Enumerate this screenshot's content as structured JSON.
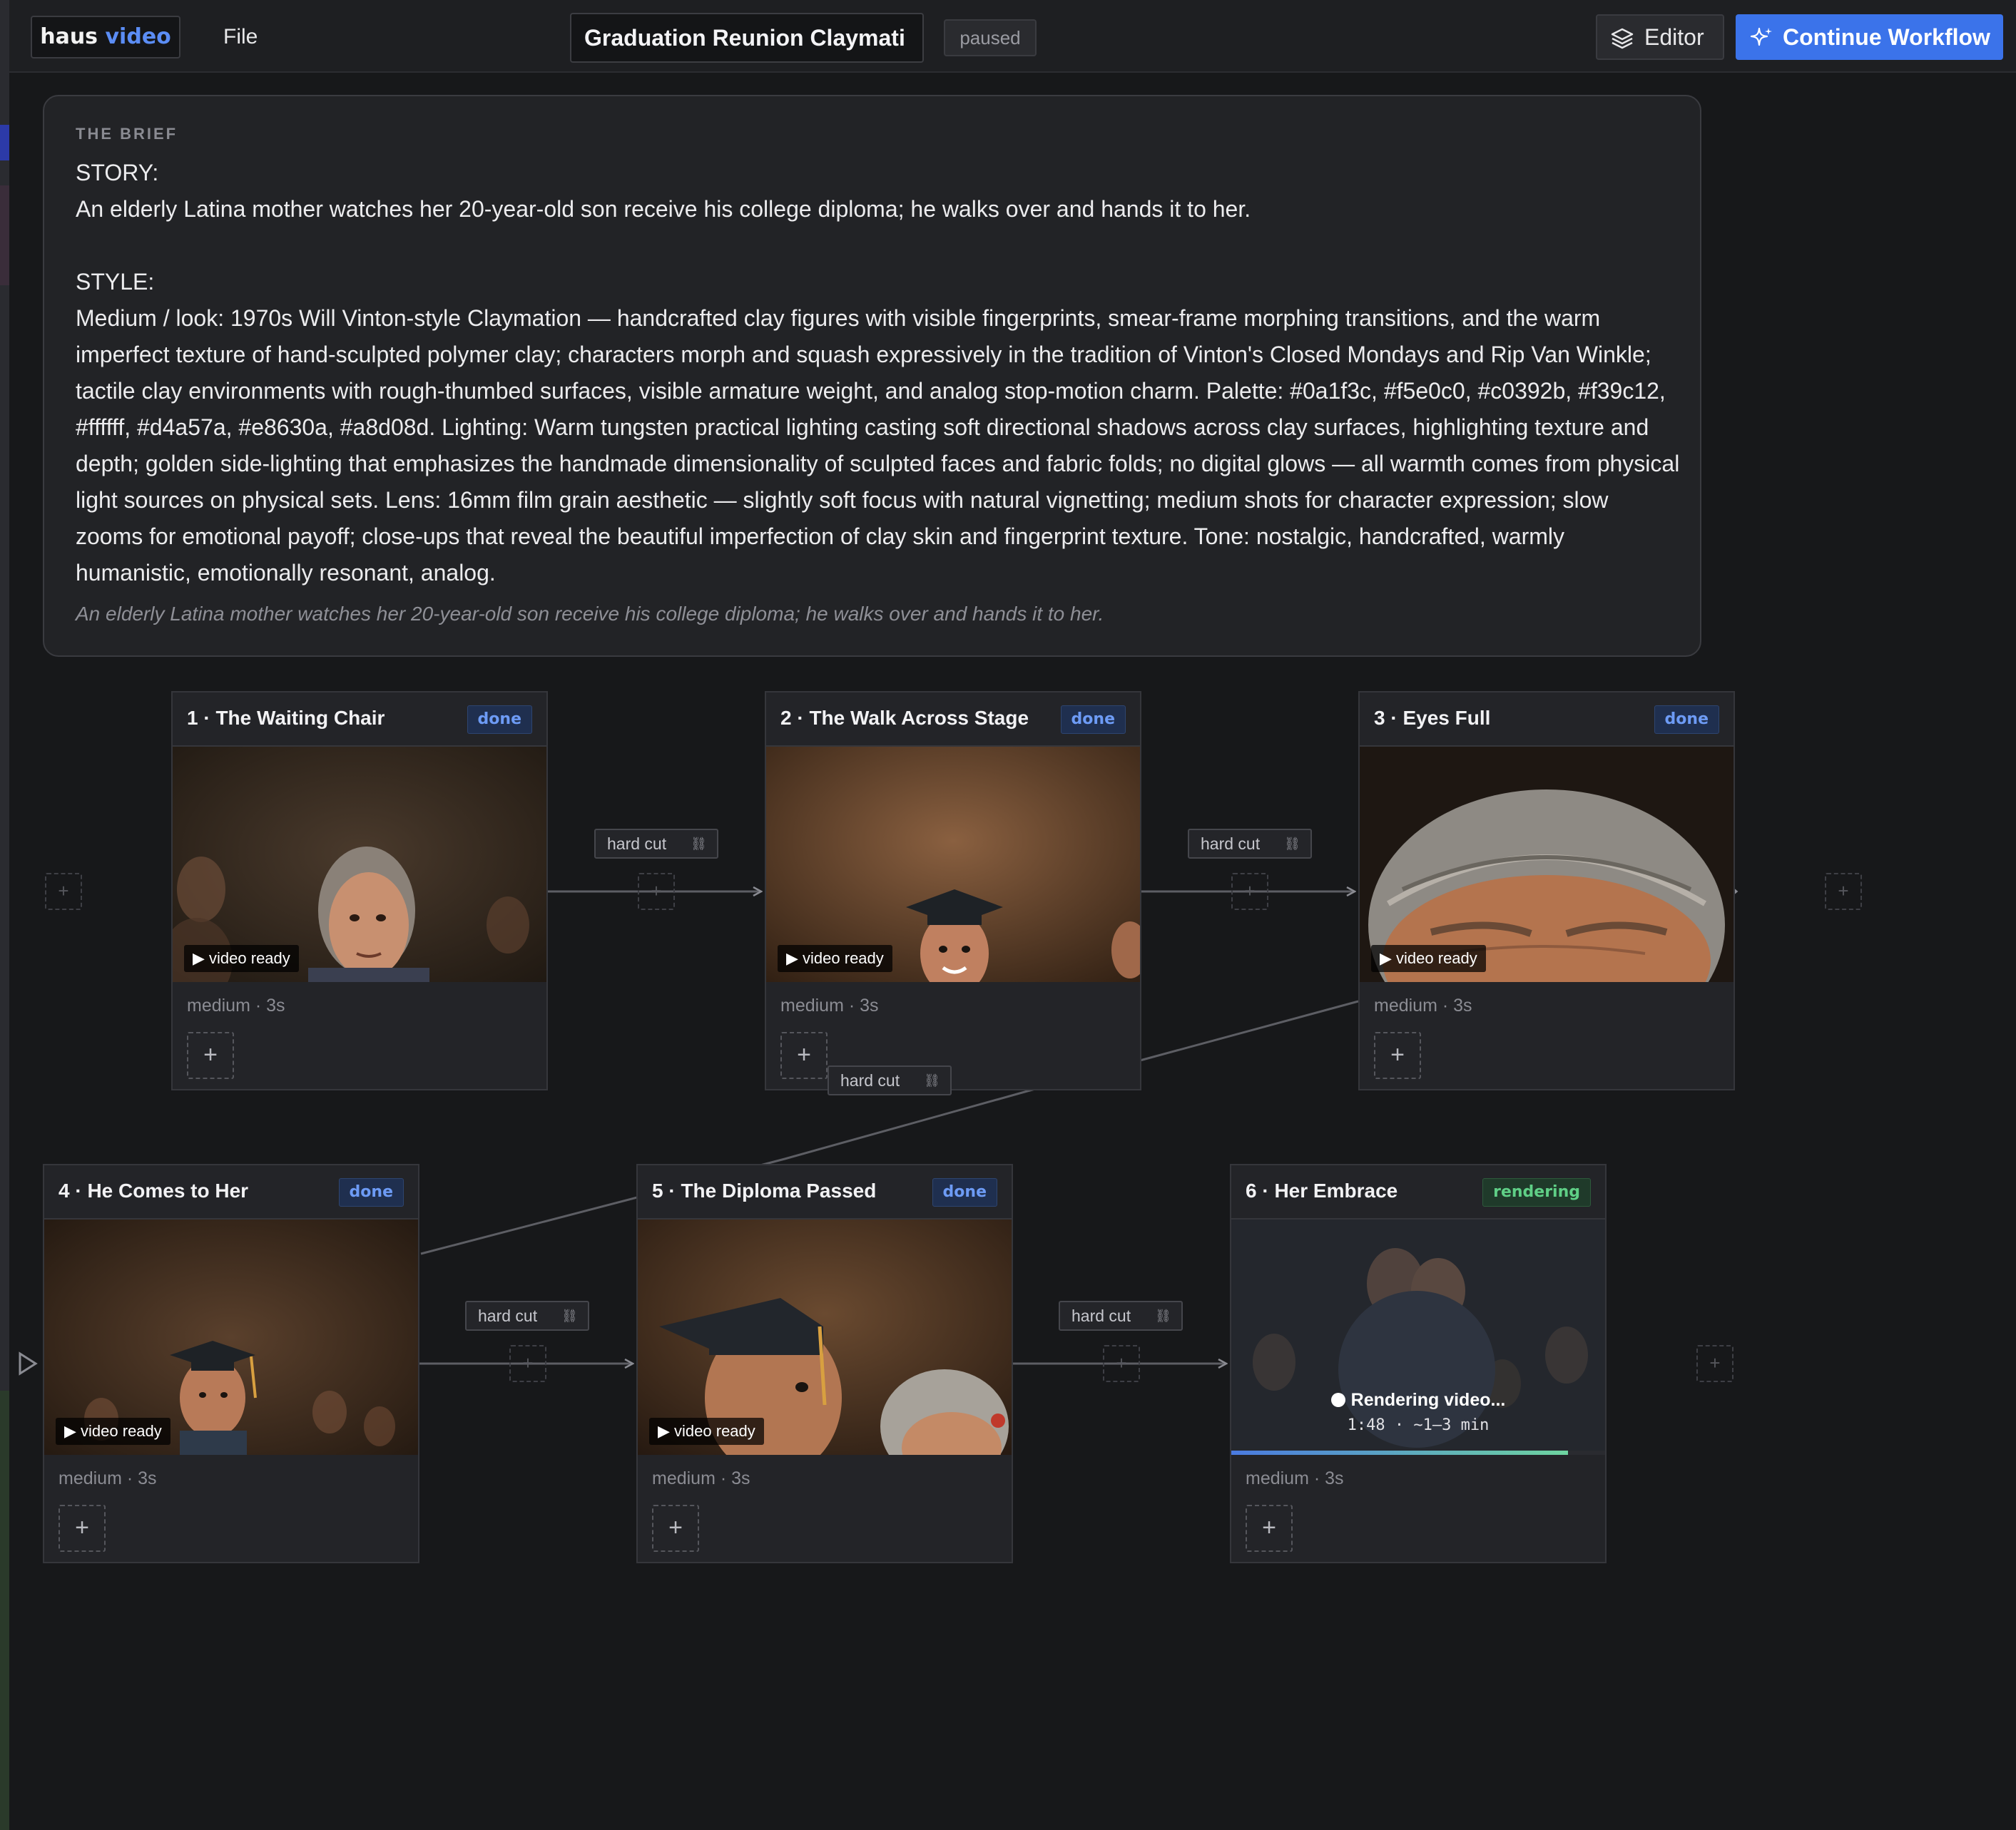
{
  "app": {
    "logo_main": "haus",
    "logo_accent": "video"
  },
  "menu": {
    "file": "File"
  },
  "project": {
    "title": "Graduation Reunion  Claymati",
    "status": "paused"
  },
  "toolbar": {
    "editor_label": "Editor",
    "continue_label": "Continue Workflow",
    "editor_icon": "layers-icon",
    "continue_icon": "sparkles-icon"
  },
  "brief": {
    "heading": "THE BRIEF",
    "body": "STORY:\nAn elderly Latina mother watches her 20-year-old son receive his college diploma; he walks over and hands it to her.\n\nSTYLE:\nMedium / look: 1970s Will Vinton-style Claymation — handcrafted clay figures with visible fingerprints, smear-frame morphing transitions, and the warm imperfect texture of hand-sculpted polymer clay; characters morph and squash expressively in the tradition of Vinton's Closed Mondays and Rip Van Winkle; tactile clay environments with rough-thumbed surfaces, visible armature weight, and analog stop-motion charm. Palette: #0a1f3c, #f5e0c0, #c0392b, #f39c12, #ffffff, #d4a57a, #e8630a, #a8d08d. Lighting: Warm tungsten practical lighting casting soft directional shadows across clay surfaces, highlighting texture and depth; golden side-lighting that emphasizes the handmade dimensionality of sculpted faces and fabric folds; no digital glows — all warmth comes from physical light sources on physical sets. Lens: 16mm film grain aesthetic — slightly soft focus with natural vignetting; medium shots for character expression; slow zooms for emotional payoff; close-ups that reveal the beautiful imperfection of clay skin and fingerprint texture. Tone: nostalgic, handcrafted, warmly humanistic, emotionally resonant, analog.",
    "summary": "An elderly Latina mother watches her 20-year-old son receive his college diploma; he walks over and hands it to her."
  },
  "shots": [
    {
      "title": "1 · The Waiting Chair",
      "status": "done",
      "overlay": "▶ video ready",
      "meta": "medium · 3s"
    },
    {
      "title": "2 · The Walk Across Stage",
      "status": "done",
      "overlay": "▶ video ready",
      "meta": "medium · 3s"
    },
    {
      "title": "3 · Eyes Full",
      "status": "done",
      "overlay": "▶ video ready",
      "meta": "medium · 3s"
    },
    {
      "title": "4 · He Comes to Her",
      "status": "done",
      "overlay": "▶ video ready",
      "meta": "medium · 3s"
    },
    {
      "title": "5 · The Diploma Passed",
      "status": "done",
      "overlay": "▶ video ready",
      "meta": "medium · 3s"
    },
    {
      "title": "6 · Her Embrace",
      "status": "rendering",
      "overlay": "Rendering video...",
      "timer": "1:48 · ~1–3 min",
      "progress": 0.9,
      "meta": "medium · 3s"
    }
  ],
  "transitions": [
    {
      "label": "hard cut",
      "icon": "link-icon"
    },
    {
      "label": "hard cut",
      "icon": "link-icon"
    },
    {
      "label": "hard cut",
      "icon": "link-icon"
    },
    {
      "label": "hard cut",
      "icon": "link-icon"
    },
    {
      "label": "hard cut",
      "icon": "link-icon"
    }
  ],
  "add_symbol": "+",
  "colors": {
    "accent": "#3b73ea",
    "done": "#6d9bf5",
    "rendering": "#5fcf86",
    "background": "#17181a"
  }
}
